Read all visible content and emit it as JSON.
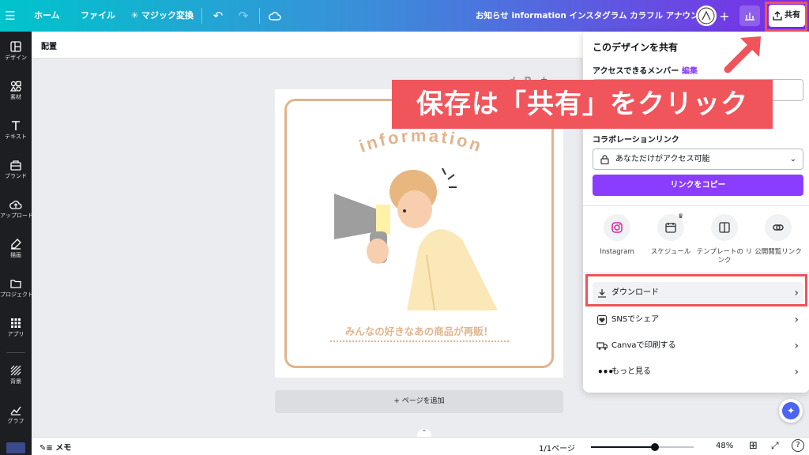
{
  "topbar": {
    "home": "ホーム",
    "file": "ファイル",
    "magic": "マジック変換",
    "doc_title": "お知らせ information インスタグラム カラフル アナウンス",
    "share": "共有"
  },
  "sidebar": {
    "items": [
      {
        "label": "デザイン",
        "icon": "layout-icon"
      },
      {
        "label": "素材",
        "icon": "elements-icon"
      },
      {
        "label": "テキスト",
        "icon": "text-icon"
      },
      {
        "label": "ブランド",
        "icon": "brand-icon"
      },
      {
        "label": "アップロード",
        "icon": "upload-icon"
      },
      {
        "label": "描画",
        "icon": "draw-icon"
      },
      {
        "label": "プロジェクト",
        "icon": "folder-icon"
      },
      {
        "label": "アプリ",
        "icon": "apps-icon"
      },
      {
        "label": "背景",
        "icon": "background-icon"
      },
      {
        "label": "グラフ",
        "icon": "chart-icon"
      }
    ]
  },
  "toolbar2": {
    "position": "配置"
  },
  "design": {
    "heading": "information",
    "caption": "みんなの好きなあの商品が再販！"
  },
  "add_page": "+ ページを追加",
  "bottombar": {
    "notes": "メモ",
    "pages": "1/1ページ",
    "zoom": "48%",
    "zoom_level": 0.62
  },
  "share_panel": {
    "title": "このデザインを共有",
    "access_label": "アクセスできるメンバー",
    "edit": "編集",
    "collab_label": "コラボレーションリンク",
    "access_value": "あなただけがアクセス可能",
    "copy_link": "リンクをコピー",
    "share_options": [
      {
        "label": "Instagram",
        "icon": "instagram-icon"
      },
      {
        "label": "スケジュール",
        "icon": "calendar-icon"
      },
      {
        "label": "テンプレートの リンク",
        "icon": "template-icon"
      },
      {
        "label": "公開閲覧リンク",
        "icon": "link-icon"
      }
    ],
    "rows": [
      {
        "label": "ダウンロード",
        "icon": "download-icon"
      },
      {
        "label": "SNSでシェア",
        "icon": "heart-icon"
      },
      {
        "label": "Canvaで印刷する",
        "icon": "truck-icon"
      },
      {
        "label": "もっと見る",
        "icon": "more-icon"
      }
    ]
  },
  "annotation": {
    "callout": "保存は「共有」をクリック"
  },
  "colors": {
    "accent": "#8b3dff",
    "annotation_red": "#f0535a",
    "frame": "#e1b48c"
  }
}
